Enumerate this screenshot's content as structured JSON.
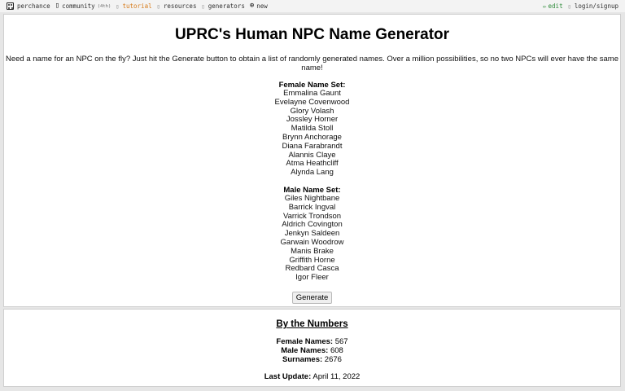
{
  "nav": {
    "brand": "perchance",
    "community": "community",
    "community_badge": "(4th)",
    "tutorial": "tutorial",
    "resources": "resources",
    "generators": "generators",
    "new": "new",
    "edit": "edit",
    "login": "login/signup",
    "icons": {
      "brand": "dice-icon",
      "community": "chat-icon",
      "tutorial": "book-icon",
      "resources": "link-icon",
      "generators": "list-icon",
      "new": "plus-circle-icon",
      "edit": "pencil-icon",
      "login": "user-icon"
    }
  },
  "main": {
    "title": "UPRC's Human NPC Name Generator",
    "intro": "Need a name for an NPC on the fly? Just hit the Generate button to obtain a list of randomly generated names. Over a million possibilities, so no two NPCs will ever have the same name!",
    "female_heading": "Female Name Set:",
    "female_names": [
      "Emmalina Gaunt",
      "Evelayne Covenwood",
      "Glory Volash",
      "Jossley Horner",
      "Matilda Stoll",
      "Brynn Anchorage",
      "Diana Farabrandt",
      "Alannis Claye",
      "Atma Heathcliff",
      "Alynda Lang"
    ],
    "male_heading": "Male Name Set:",
    "male_names": [
      "Giles Nightbane",
      "Barrick Ingval",
      "Varrick Trondson",
      "Aldrich Covington",
      "Jenkyn Saldeen",
      "Garwain Woodrow",
      "Manis Brake",
      "Griffith Horne",
      "Redbard Casca",
      "Igor Fleer"
    ],
    "generate_label": "Generate"
  },
  "stats": {
    "title": "By the Numbers",
    "female_label": "Female Names:",
    "female_value": "567",
    "male_label": "Male Names:",
    "male_value": "608",
    "surnames_label": "Surnames:",
    "surnames_value": "2676",
    "update_label": "Last Update:",
    "update_value": "April 11, 2022"
  },
  "colors": {
    "tutorial": "#d77b1a",
    "edit": "#2e8b3a",
    "background": "#e6e6e6"
  }
}
